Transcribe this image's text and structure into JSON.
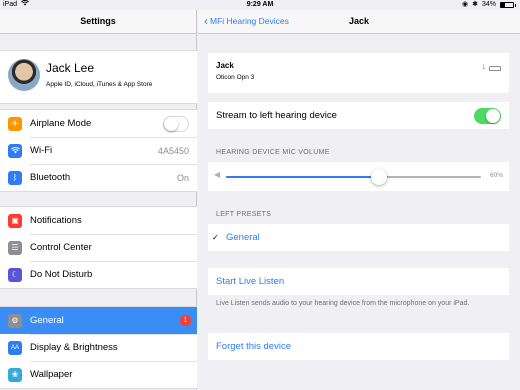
{
  "status_bar": {
    "device": "iPad",
    "wifi_icon": "wifi-icon",
    "time": "9:29 AM",
    "battery_percent": "34%",
    "battery_level": 0.34
  },
  "master": {
    "title": "Settings",
    "profile": {
      "name": "Jack Lee",
      "subtitle": "Apple ID, iCloud, iTunes & App Store"
    },
    "group1": [
      {
        "label": "Airplane Mode",
        "icon": "airplane-icon",
        "color": "#ff9500",
        "control": "toggle",
        "on": false
      },
      {
        "label": "Wi-Fi",
        "icon": "wifi-icon",
        "color": "#2f7cf6",
        "value": "4A5450"
      },
      {
        "label": "Bluetooth",
        "icon": "bluetooth-icon",
        "color": "#2f7cf6",
        "value": "On"
      }
    ],
    "group2": [
      {
        "label": "Notifications",
        "icon": "notifications-icon",
        "color": "#ff3b30"
      },
      {
        "label": "Control Center",
        "icon": "control-center-icon",
        "color": "#8e8e93"
      },
      {
        "label": "Do Not Disturb",
        "icon": "moon-icon",
        "color": "#5856d6"
      }
    ],
    "group3": [
      {
        "label": "General",
        "icon": "gear-icon",
        "color": "#8e8e93",
        "badge": "1",
        "selected": true
      },
      {
        "label": "Display & Brightness",
        "icon": "display-icon",
        "color": "#2f7cf6"
      },
      {
        "label": "Wallpaper",
        "icon": "wallpaper-icon",
        "color": "#34aadc"
      }
    ]
  },
  "detail": {
    "back_label": "MFi Hearing Devices",
    "title": "Jack",
    "device": {
      "name": "Jack",
      "model": "Oticon Opn 3",
      "side": "L"
    },
    "stream_label": "Stream to left hearing device",
    "stream_on": true,
    "mic_volume_header": "HEARING DEVICE MIC VOLUME",
    "mic_volume": 0.6,
    "mic_volume_label": "60%",
    "presets_header": "LEFT PRESETS",
    "preset_selected": "General",
    "live_listen_label": "Start Live Listen",
    "live_listen_footer": "Live Listen sends audio to your hearing device from the microphone on your iPad.",
    "forget_label": "Forget this device"
  }
}
